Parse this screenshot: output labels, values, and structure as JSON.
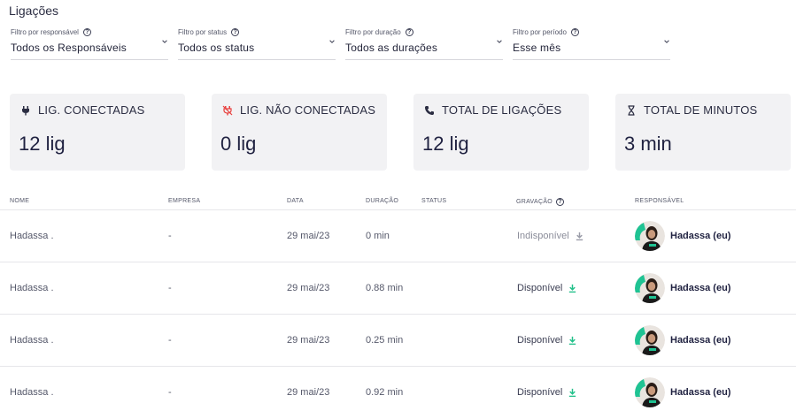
{
  "page": {
    "title": "Ligações"
  },
  "filters": [
    {
      "label": "Filtro por responsável",
      "value": "Todos os Responsáveis"
    },
    {
      "label": "Filtro por status",
      "value": "Todos os status"
    },
    {
      "label": "Filtro por duração",
      "value": "Todos as durações"
    },
    {
      "label": "Filtro por período",
      "value": "Esse mês"
    }
  ],
  "cards": [
    {
      "label": "LIG. CONECTADAS",
      "value": "12 lig",
      "icon": "plug-icon"
    },
    {
      "label": "LIG. NÃO CONECTADAS",
      "value": "0 lig",
      "icon": "unplugged-icon",
      "icon_color": "#e8403e"
    },
    {
      "label": "TOTAL DE LIGAÇÕES",
      "value": "12 lig",
      "icon": "phone-icon"
    },
    {
      "label": "TOTAL DE MINUTOS",
      "value": "3 min",
      "icon": "hourglass-icon"
    }
  ],
  "table": {
    "columns": {
      "nome": "NOME",
      "empresa": "EMPRESA",
      "data": "DATA",
      "duracao": "DURAÇÃO",
      "status": "STATUS",
      "gravacao": "GRAVAÇÃO",
      "responsavel": "RESPONSÁVEL"
    },
    "rows": [
      {
        "nome": "Hadassa .",
        "empresa": "-",
        "data": "29 mai/23",
        "duracao": "0 min",
        "status": "",
        "gravacao": "Indisponível",
        "responsavel": "Hadassa (eu)"
      },
      {
        "nome": "Hadassa .",
        "empresa": "-",
        "data": "29 mai/23",
        "duracao": "0.88 min",
        "status": "",
        "gravacao": "Disponível",
        "responsavel": "Hadassa (eu)"
      },
      {
        "nome": "Hadassa .",
        "empresa": "-",
        "data": "29 mai/23",
        "duracao": "0.25 min",
        "status": "",
        "gravacao": "Disponível",
        "responsavel": "Hadassa (eu)"
      },
      {
        "nome": "Hadassa .",
        "empresa": "-",
        "data": "29 mai/23",
        "duracao": "0.92 min",
        "status": "",
        "gravacao": "Disponível",
        "responsavel": "Hadassa (eu)"
      }
    ]
  },
  "colors": {
    "download_available": "#22c08a",
    "download_unavailable": "#9a9ca8",
    "avatar_accent": "#1fc393"
  }
}
